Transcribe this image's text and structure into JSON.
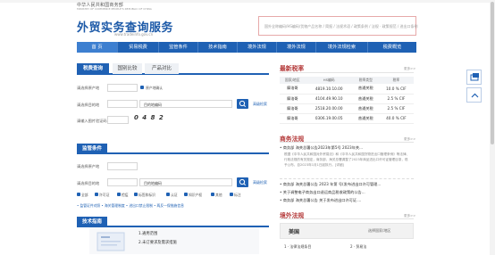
{
  "header": {
    "ministry": "中华人民共和国商务部",
    "ministry_en": "MINISTRY OF COMMERCE PEOPLE'S REPUBLIC OF CHINA",
    "title": "外贸实务查询服务",
    "url": "www.tradeinfo.gov.cn",
    "search_placeholder": "国外全称编码/HS编码/货物产品名称 / 简报 / 法规术语 / 政策条例 / 法规 · 政策规范 / 进出口条例"
  },
  "nav": {
    "items": [
      "首 页",
      "贸易税费",
      "监管条件",
      "技术指南",
      "境外法规",
      "境外法规",
      "境外法规检索",
      "税费概览"
    ]
  },
  "tariff_query": {
    "tabs": [
      "税费查询",
      "国别比较",
      "产品对比"
    ],
    "origin_label": "请选择原产地",
    "import_checkbox_label": "原产地确认",
    "dest_label": "请选择目的地",
    "hs_placeholder": "目的地编码",
    "advanced_link": "高级检索",
    "captcha_label": "请输入图片验证码",
    "captcha_text": "0 4 8 2"
  },
  "regulation_query": {
    "title": "监管条件",
    "origin_label": "请选择原产地",
    "dest_label": "请选择目的地",
    "hs_placeholder": "目的地编码",
    "advanced_link": "高级检索",
    "condition_checks": [
      "全部",
      "许可证",
      "检疫",
      "标签和标识",
      "认证",
      "知识产权",
      "其他",
      "标注"
    ],
    "quick_links": "• 监管证件对照  • 海关管理制度  • 进出口禁止限制  • 两反一保措施信息"
  },
  "tech_guide": {
    "title": "技术指南",
    "items": [
      "1.通用范围",
      "2.未订要求及需求措施"
    ]
  },
  "tariff_rates": {
    "title": "最新税率",
    "more": "更多>>",
    "headers": [
      "国家/地区",
      "HS编码",
      "税率类型",
      "税率"
    ],
    "rows": [
      [
        "摩洛哥",
        "4819.10.10.00",
        "普通关税",
        "10.0 % CIF"
      ],
      [
        "摩洛哥",
        "4104.49.90.10",
        "普通关税",
        "2.5 % CIF"
      ],
      [
        "摩洛哥",
        "2518.20.00.00",
        "普通关税",
        "2.5 % CIF"
      ],
      [
        "摩洛哥",
        "0306.19.00.05",
        "普通关税",
        "40.0 % CIF"
      ]
    ]
  },
  "commerce_laws": {
    "title": "商务法规",
    "more": "更多>>",
    "items": [
      "• 商务部 海关总署公告2023年第5号 2023年关...",
      "• 商务部 海关总署公告 2023 年第 号(发布进出口许可管理...",
      "• 关于调整电子商务出口退运商品税收政策的公告...",
      "• 商务部 海关总署公告 关于发布进出口许可证...."
    ],
    "desc": "根据《中华人民共和国对外贸易法》和《中华人民共和国货物进出口管理条例》等法律、行政法规的有关规定，商务部、海关总署调整了2023年商品进出口许可证管理目录，现予公布，自2023年1月1日起执行。[详细]"
  },
  "foreign_laws": {
    "title": "境外法规",
    "more": "更多>>",
    "country": "美国",
    "select_label": "选择国家/地区",
    "items": [
      "1 · 法律法规条目",
      "2 · 贸易法"
    ]
  },
  "sidebar": {
    "wechat_icon": "share-icon",
    "top_icon": "chevron-up-icon"
  }
}
